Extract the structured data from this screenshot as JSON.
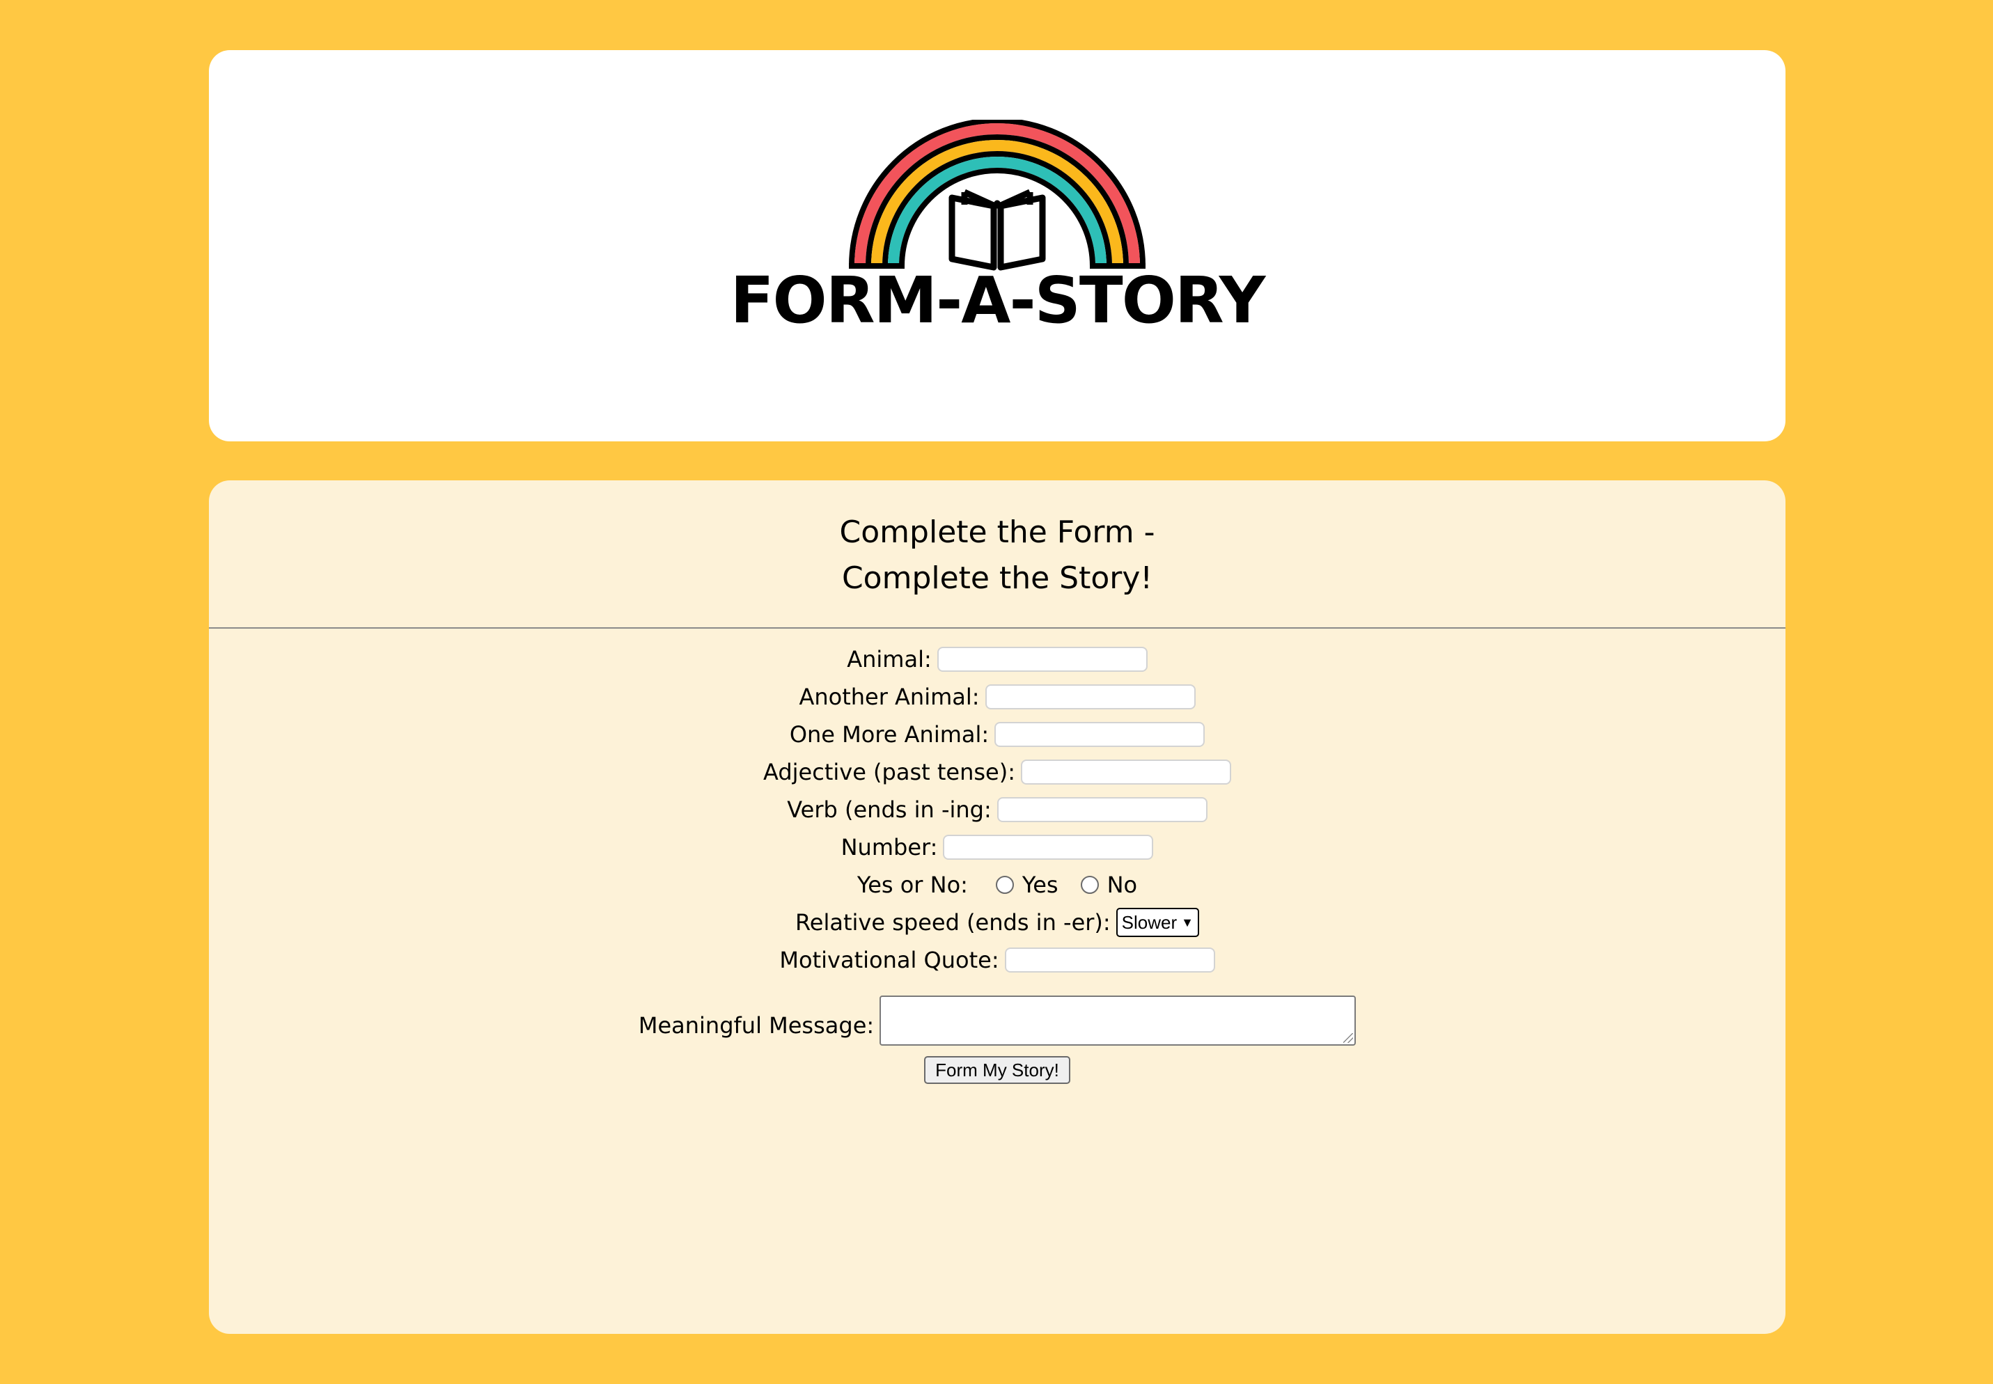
{
  "header": {
    "logo_text": "FORM-A-STORY",
    "logo_icon": "rainbow-book-icon"
  },
  "form": {
    "title_line1": "Complete the Form -",
    "title_line2": "Complete the Story!",
    "fields": {
      "animal": {
        "label": "Animal:",
        "value": ""
      },
      "another_animal": {
        "label": "Another Animal:",
        "value": ""
      },
      "one_more_animal": {
        "label": "One More Animal:",
        "value": ""
      },
      "adjective": {
        "label": "Adjective (past tense):",
        "value": ""
      },
      "verb": {
        "label": "Verb (ends in -ing:",
        "value": ""
      },
      "number": {
        "label": "Number:",
        "value": ""
      },
      "yes_no": {
        "label": "Yes or No:",
        "option_yes": "Yes",
        "option_no": "No",
        "selected": ""
      },
      "speed": {
        "label": "Relative speed (ends in -er):",
        "selected": "Slower"
      },
      "quote": {
        "label": "Motivational Quote:",
        "value": ""
      },
      "message": {
        "label": "Meaningful Message:",
        "value": ""
      }
    },
    "submit_label": "Form My Story!"
  },
  "colors": {
    "page_background": "#ffc843",
    "header_card": "#ffffff",
    "form_card": "#fdf2d8",
    "rainbow_red": "#f2545b",
    "rainbow_yellow": "#fbb81c",
    "rainbow_teal": "#2ebfb7"
  }
}
